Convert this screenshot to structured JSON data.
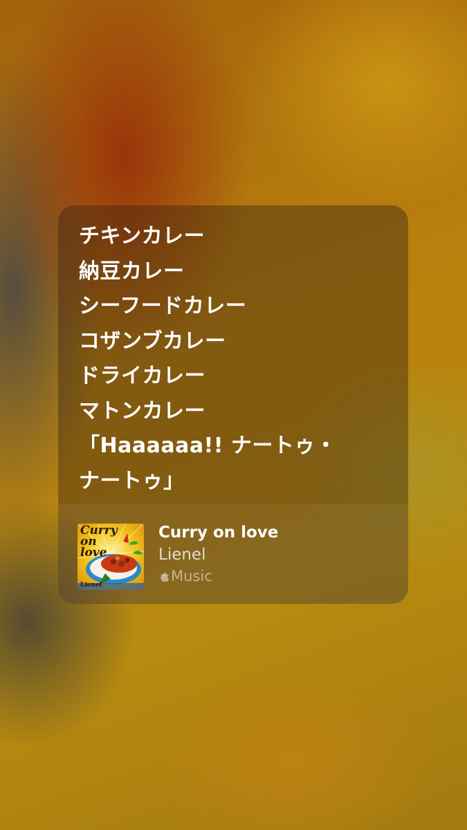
{
  "lyrics": [
    "チキンカレー",
    "納豆カレー",
    "シーフードカレー",
    "コザンブカレー",
    "ドライカレー",
    "マトンカレー",
    "「Haaaaaa!! ナートゥ・",
    "ナートゥ」"
  ],
  "track": {
    "title": "Curry on love",
    "artist": "Lienel",
    "service": "Music"
  },
  "artwork": {
    "title_lines": [
      "Curry",
      "on",
      "love"
    ],
    "artist": "Lienel"
  },
  "colors": {
    "card_tint": "#372314",
    "text_primary": "#ffffff"
  }
}
